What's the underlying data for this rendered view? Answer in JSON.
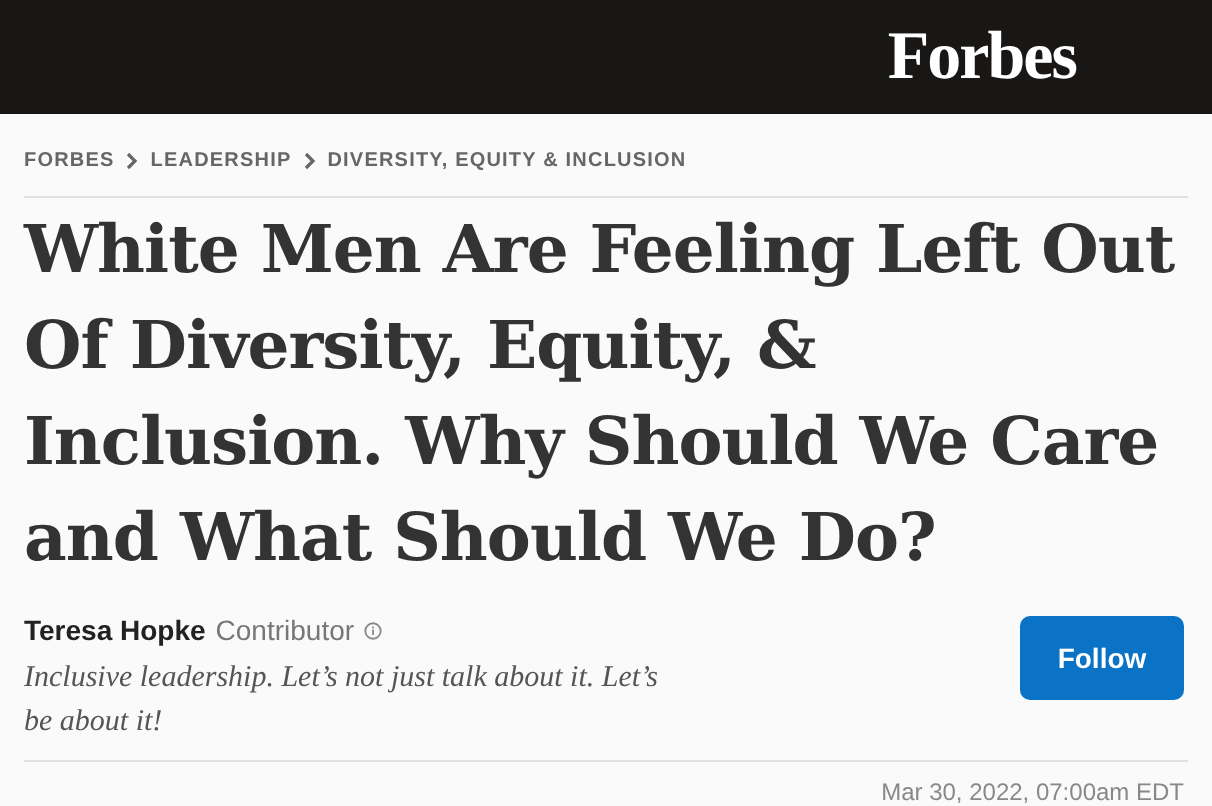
{
  "header": {
    "logo": "Forbes"
  },
  "breadcrumbs": [
    {
      "label": "FORBES"
    },
    {
      "label": "LEADERSHIP"
    },
    {
      "label": "DIVERSITY, EQUITY & INCLUSION"
    }
  ],
  "headline": "White Men Are Feeling Left Out Of Diversity, Equity, & Inclusion. Why Should We Care and What Should We Do?",
  "author": {
    "name": "Teresa Hopke",
    "role": "Contributor",
    "tagline": "Inclusive leadership. Let’s not just talk about it. Let’s be about it!"
  },
  "follow_button": "Follow",
  "date": "Mar 30, 2022, 07:00am EDT"
}
